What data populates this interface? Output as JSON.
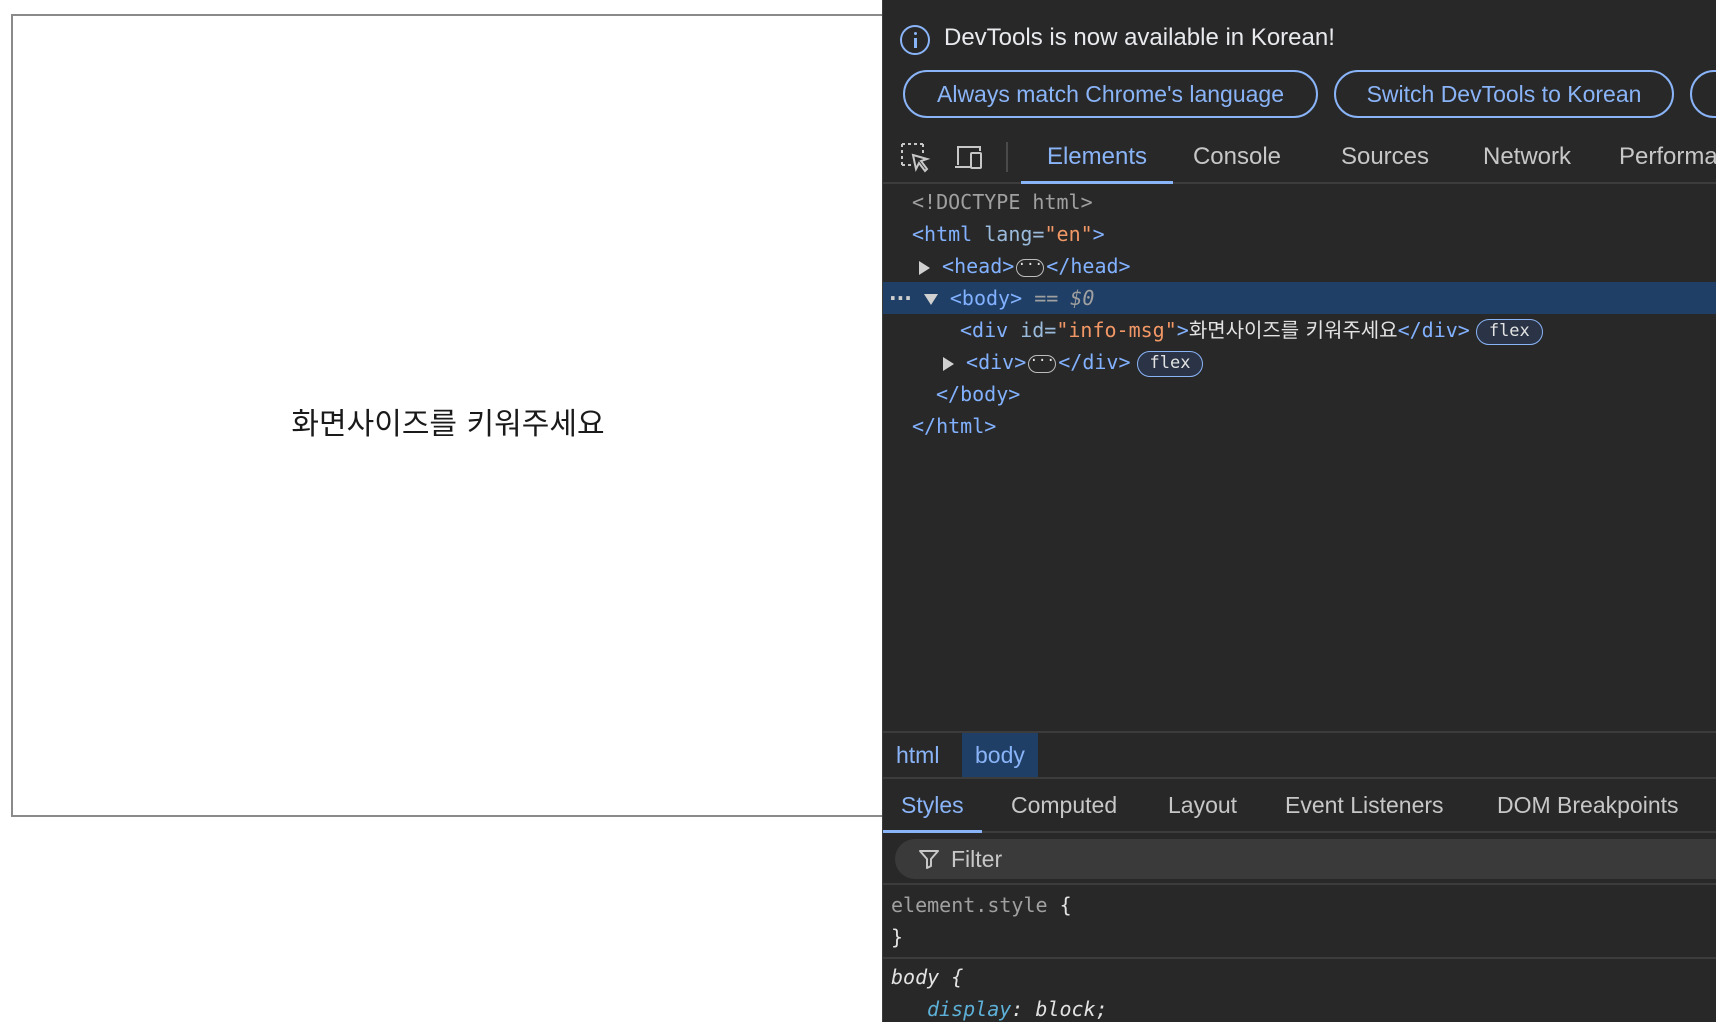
{
  "page": {
    "message": "화면사이즈를 키워주세요"
  },
  "devtools": {
    "infobar": {
      "message": "DevTools is now available in Korean!",
      "button_match": "Always match Chrome's language",
      "button_switch": "Switch DevTools to Korean"
    },
    "tabs": [
      "Elements",
      "Console",
      "Sources",
      "Network",
      "Performa"
    ],
    "active_tab": "Elements",
    "dom": {
      "doctype": "<!DOCTYPE html>",
      "html_open_tag": "<html",
      "html_attr_name": "lang=",
      "html_attr_value": "\"en\"",
      "html_close_bracket": ">",
      "head_open": "<head>",
      "head_close": "</head>",
      "body_open": "<body>",
      "body_selected_marker": "== $0",
      "div_open": "<div",
      "div_attr_name": "id=",
      "div_attr_value": "\"info-msg\"",
      "div_close_bracket": ">",
      "div_text": "화면사이즈를 키워주세요",
      "div_close": "</div>",
      "badge_flex": "flex",
      "div2_open": "<div>",
      "div2_close": "</div>",
      "body_close": "</body>",
      "html_close": "</html>"
    },
    "breadcrumb": [
      "html",
      "body"
    ],
    "styles_tabs": [
      "Styles",
      "Computed",
      "Layout",
      "Event Listeners",
      "DOM Breakpoints"
    ],
    "active_styles_tab": "Styles",
    "filter_placeholder": "Filter",
    "rules": {
      "element_style_selector": "element.style",
      "open_brace": "{",
      "close_brace": "}",
      "body_selector": "body",
      "body_prop": "display",
      "body_value": "block;"
    },
    "colors": {
      "accent": "#8ab4f8",
      "background": "#282828",
      "selected_row": "#1f3f66"
    }
  }
}
